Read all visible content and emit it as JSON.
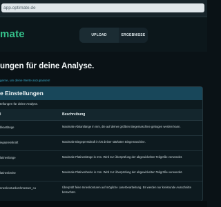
{
  "browser": {
    "url": "app.optimate.de"
  },
  "nav": {
    "logo_text": "mate",
    "upload_label": "UPLOAD",
    "results_label": "ERGEBNISSE"
  },
  "page": {
    "heading": "ungen für deine Analyse.",
    "sublink": "gerne, um deine Werte anzupassen!"
  },
  "settings": {
    "title": "e Einstellungen",
    "description": "tellungen für deine Analyse.",
    "columns": {
      "key": "l",
      "description": "Beschreibung"
    },
    "rows": [
      {
        "key": "bkantlänge",
        "description": "Maximale Abkantlänge in mm, die auf deiner größten Biegemaschine gebogen werden kann."
      },
      {
        "key": "iegepresskraft",
        "description": "Maximale Biegepresskraft in kN deiner stärksten Biegemaschine."
      },
      {
        "key": "latinenlänge",
        "description": "Maximale Platinenlänge in mm. Wird zur Überprüfung der abgewickelten Teilgröße verwendet."
      },
      {
        "key": "latinenbreite",
        "description": "Maximale Platinenbreite in mm. Wird zur Überprüfung der abgewickelten Teilgröße verwendet."
      },
      {
        "key": "nnenkonturdurchmesser_cu",
        "description": "Überprüft feine Innenkonturen auf mögliche Laserbearbeitung. Es werden nur kreisrunde Ausschnitte betrachtet."
      }
    ]
  },
  "colors": {
    "background": "#0a1216",
    "accent_green": "#35c08a",
    "panel_header": "#18475a",
    "link": "#39a9c9"
  }
}
